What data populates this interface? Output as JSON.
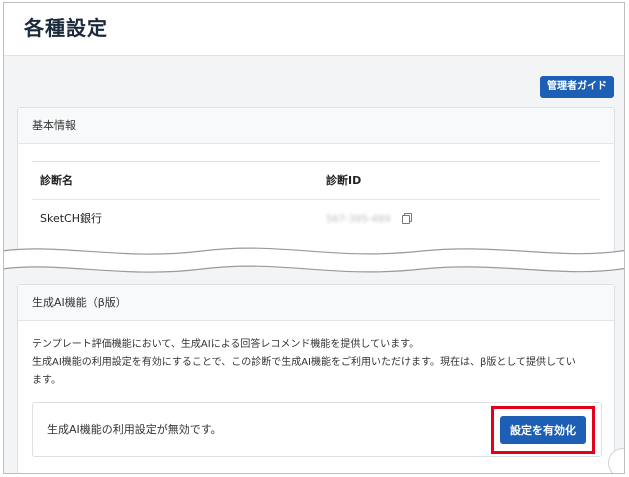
{
  "header": {
    "title": "各種設定"
  },
  "toolbar": {
    "guide_label": "管理者ガイド"
  },
  "basic_info": {
    "title": "基本情報",
    "columns": [
      "診断名",
      "診断ID"
    ],
    "row": {
      "name": "SketCH銀行",
      "id": "567-395-489"
    }
  },
  "ai_feature": {
    "title": "生成AI機能（β版）",
    "description_lines": [
      "テンプレート評価機能において、生成AIによる回答レコメンド機能を提供しています。",
      "生成AI機能の利用設定を有効にすることで、この診断で生成AI機能をご利用いただけます。現在は、β版として提供してい",
      "ます。"
    ],
    "status_text": "生成AI機能の利用設定が無効です。",
    "enable_label": "設定を有効化"
  },
  "colors": {
    "primary": "#1d5fb4",
    "highlight": "#e2001a",
    "background": "#f3f4f6"
  }
}
